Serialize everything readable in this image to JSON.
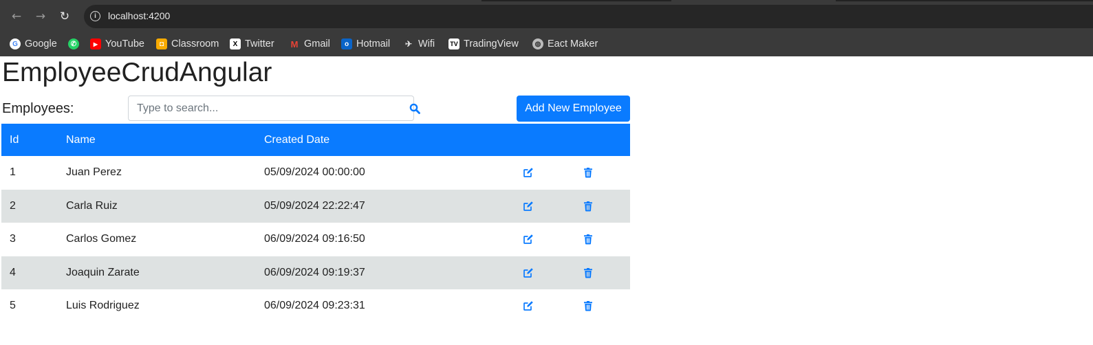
{
  "browser": {
    "url": "localhost:4200",
    "bookmarks": [
      {
        "label": "Google",
        "icon": "google-icon",
        "color": "#ffffff"
      },
      {
        "label": "",
        "icon": "whatsapp-icon",
        "color": "#25d366"
      },
      {
        "label": "YouTube",
        "icon": "youtube-icon",
        "color": "#ff0000"
      },
      {
        "label": "Classroom",
        "icon": "classroom-icon",
        "color": "#f9ab00"
      },
      {
        "label": "Twitter",
        "icon": "x-icon",
        "color": "#ffffff"
      },
      {
        "label": "Gmail",
        "icon": "gmail-icon",
        "color": "#ea4335"
      },
      {
        "label": "Hotmail",
        "icon": "outlook-icon",
        "color": "#0a64c8"
      },
      {
        "label": "Wifi",
        "icon": "wifi-icon",
        "color": "#555555"
      },
      {
        "label": "TradingView",
        "icon": "tradingview-icon",
        "color": "#000000"
      },
      {
        "label": "Eact Maker",
        "icon": "globe-icon",
        "color": "#cccccc"
      }
    ]
  },
  "app": {
    "title": "EmployeeCrudAngular",
    "employees_label": "Employees:",
    "search_placeholder": "Type to search...",
    "add_button": "Add New Employee",
    "accent": "#0a7bff"
  },
  "table": {
    "columns": [
      "Id",
      "Name",
      "Created Date"
    ],
    "rows": [
      {
        "id": "1",
        "name": "Juan Perez",
        "created": "05/09/2024 00:00:00"
      },
      {
        "id": "2",
        "name": "Carla Ruiz",
        "created": "05/09/2024 22:22:47"
      },
      {
        "id": "3",
        "name": "Carlos Gomez",
        "created": "06/09/2024 09:16:50"
      },
      {
        "id": "4",
        "name": "Joaquin Zarate",
        "created": "06/09/2024 09:19:37"
      },
      {
        "id": "5",
        "name": "Luis Rodriguez",
        "created": "06/09/2024 09:23:31"
      }
    ]
  }
}
